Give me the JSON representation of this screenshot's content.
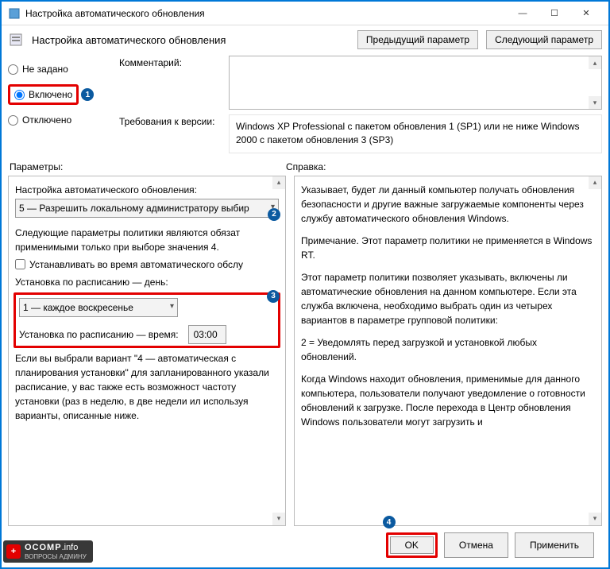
{
  "window": {
    "title": "Настройка автоматического обновления",
    "minimize_icon": "—",
    "maximize_icon": "☐",
    "close_icon": "✕"
  },
  "header": {
    "title": "Настройка автоматического обновления",
    "prev_button": "Предыдущий параметр",
    "next_button": "Следующий параметр"
  },
  "radios": {
    "not_configured": "Не задано",
    "enabled": "Включено",
    "disabled": "Отключено"
  },
  "labels": {
    "comment": "Комментарий:",
    "requirements": "Требования к версии:",
    "options": "Параметры:",
    "help": "Справка:"
  },
  "requirements_text": "Windows XP Professional с пакетом обновления 1 (SP1) или не ниже Windows 2000 с пакетом обновления 3 (SP3)",
  "options": {
    "heading": "Настройка автоматического обновления:",
    "mode_value": "5 — Разрешить локальному администратору выбир",
    "policy_note": "Следующие параметры политики являются обязат применимыми только при выборе значения 4.",
    "checkbox_label": "Устанавливать во время автоматического обслу",
    "schedule_day_label": "Установка по расписанию — день:",
    "schedule_day_value": "1 — каждое воскресенье",
    "schedule_time_label": "Установка по расписанию — время:",
    "schedule_time_value": "03:00",
    "tail_text": "Если вы выбрали вариант \"4 — автоматическая с планирования установки\" для запланированного указали расписание, у вас также есть возможност частоту установки (раз в неделю, в две недели ил используя варианты, описанные ниже."
  },
  "help": {
    "p1": "Указывает, будет ли данный компьютер получать обновления безопасности и другие важные загружаемые компоненты через службу автоматического обновления Windows.",
    "p2": "Примечание. Этот параметр политики не применяется в Windows RT.",
    "p3": "Этот параметр политики позволяет указывать, включены ли автоматические обновления на данном компьютере. Если эта служба включена, необходимо выбрать один из четырех вариантов в параметре групповой политики:",
    "p4": "    2 = Уведомлять перед загрузкой и установкой любых обновлений.",
    "p5": "    Когда Windows находит обновления, применимые для данного компьютера, пользователи получают уведомление о готовности обновлений к загрузке. После перехода в Центр обновления Windows пользователи могут загрузить и"
  },
  "footer": {
    "ok": "OK",
    "cancel": "Отмена",
    "apply": "Применить"
  },
  "badges": {
    "b1": "1",
    "b2": "2",
    "b3": "3",
    "b4": "4"
  },
  "logo": {
    "brand": "OCOMP",
    "suffix": ".info",
    "tagline": "ВОПРОСЫ АДМИНУ"
  }
}
